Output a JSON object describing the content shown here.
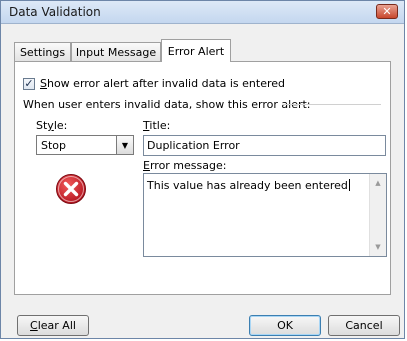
{
  "window": {
    "title": "Data Validation",
    "close_glyph": "✕"
  },
  "tabs": [
    {
      "label": "Settings",
      "active": false
    },
    {
      "label": "Input Message",
      "active": false
    },
    {
      "label": "Error Alert",
      "active": true
    }
  ],
  "error_alert": {
    "show_alert": {
      "checked": true,
      "label_accel": "S",
      "label_rest": "how error alert after invalid data is entered"
    },
    "group_label": "When user enters invalid data, show this error alert:",
    "style_label_pre": "St",
    "style_label_accel": "y",
    "style_label_post": "le:",
    "style_value": "Stop",
    "style_icon": "stop-icon",
    "title_label_accel": "T",
    "title_label_rest": "itle:",
    "title_value": "Duplication Error",
    "message_label_accel": "E",
    "message_label_rest": "rror message:",
    "message_value": "This value has already been entered"
  },
  "buttons": {
    "clear_all_accel": "C",
    "clear_all_rest": "lear All",
    "ok": "OK",
    "cancel": "Cancel"
  },
  "colors": {
    "title_bar": "#c4d7ef",
    "close_button": "#c8472d",
    "stop_icon": "#c8102e"
  }
}
